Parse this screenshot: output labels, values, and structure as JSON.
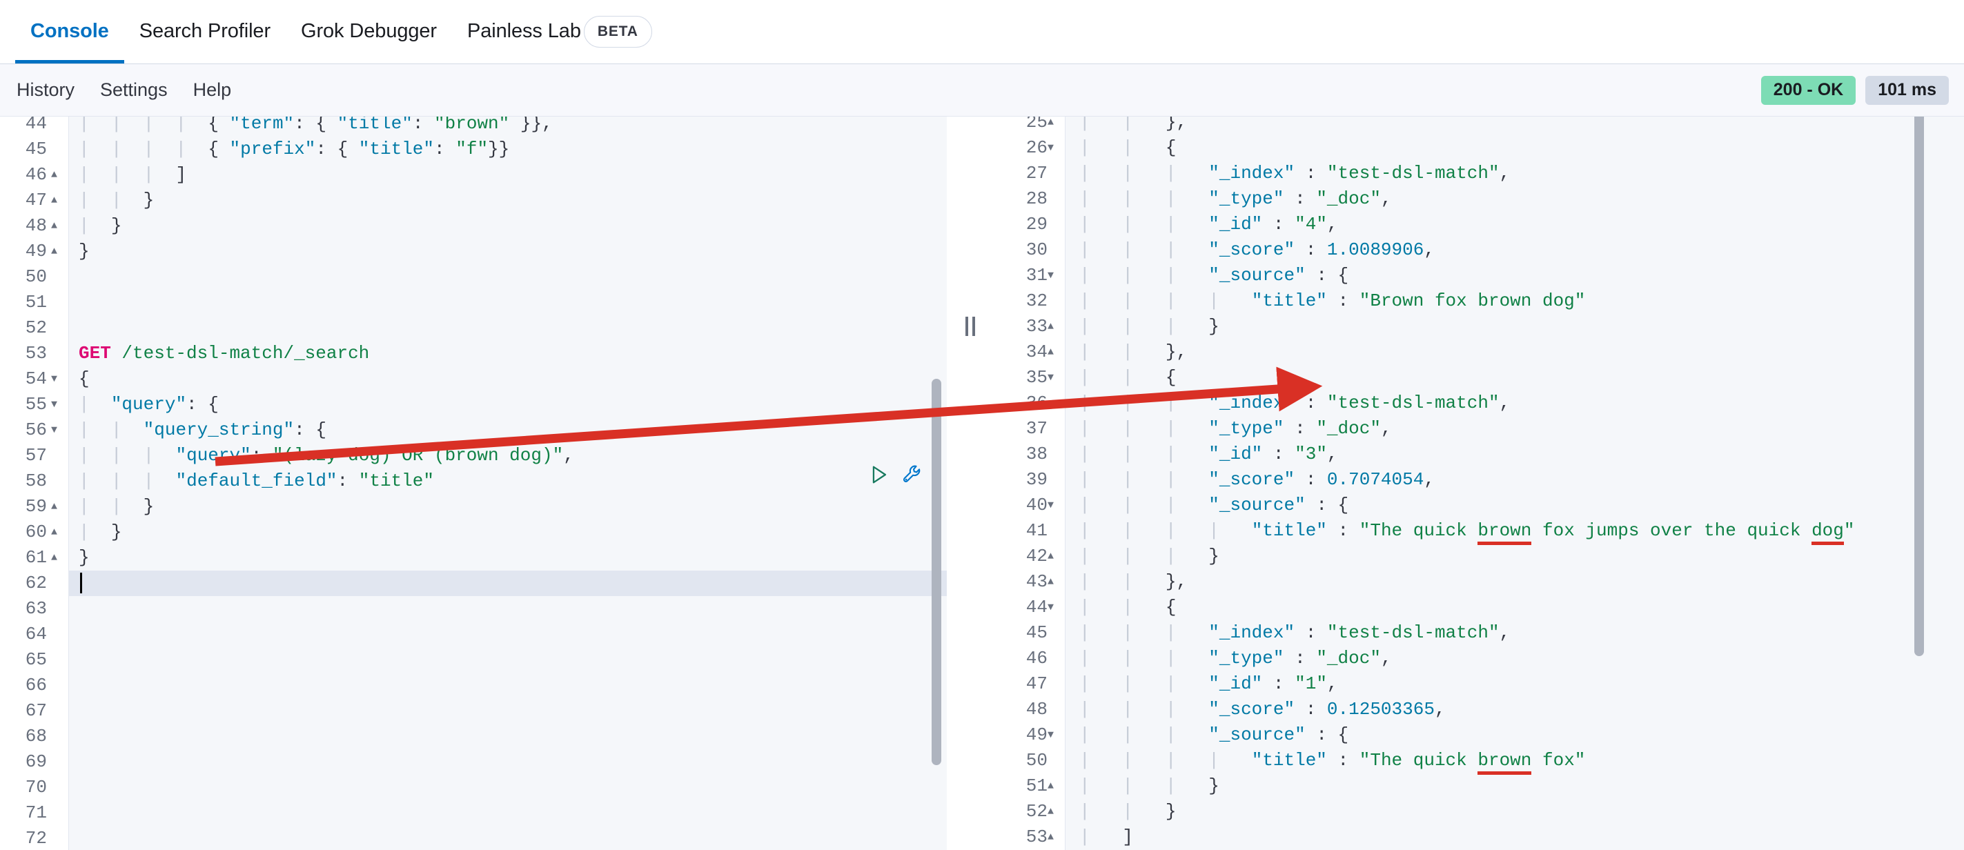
{
  "tabs": [
    {
      "label": "Console",
      "active": true
    },
    {
      "label": "Search Profiler",
      "active": false
    },
    {
      "label": "Grok Debugger",
      "active": false
    },
    {
      "label": "Painless Lab",
      "active": false
    }
  ],
  "beta_badge": "BETA",
  "subbar": {
    "items": [
      "History",
      "Settings",
      "Help"
    ],
    "status_code": "200 - OK",
    "status_time": "101 ms",
    "status_ok_color": "#7DDCB5",
    "status_time_color": "#D3DAE6"
  },
  "editor": {
    "icons": {
      "run": "play-icon",
      "wrench": "wrench-icon"
    },
    "active_line": 62,
    "lines": [
      {
        "n": 44,
        "fold": "",
        "text": "{ \"term\": { \"title\": \"brown\" }},"
      },
      {
        "n": 45,
        "fold": "",
        "text": "{ \"prefix\": { \"title\": \"f\"}}"
      },
      {
        "n": 46,
        "fold": "▲",
        "text": "]"
      },
      {
        "n": 47,
        "fold": "▲",
        "text": "}"
      },
      {
        "n": 48,
        "fold": "▲",
        "text": "}"
      },
      {
        "n": 49,
        "fold": "▲",
        "text": "}"
      },
      {
        "n": 50,
        "fold": "",
        "text": ""
      },
      {
        "n": 51,
        "fold": "",
        "text": ""
      },
      {
        "n": 52,
        "fold": "",
        "text": ""
      },
      {
        "n": 53,
        "fold": "",
        "text": "GET /test-dsl-match/_search"
      },
      {
        "n": 54,
        "fold": "▼",
        "text": "{"
      },
      {
        "n": 55,
        "fold": "▼",
        "text": "\"query\": {"
      },
      {
        "n": 56,
        "fold": "▼",
        "text": "\"query_string\": {"
      },
      {
        "n": 57,
        "fold": "",
        "text": "\"query\": \"(lazy dog) OR (brown dog)\","
      },
      {
        "n": 58,
        "fold": "",
        "text": "\"default_field\": \"title\""
      },
      {
        "n": 59,
        "fold": "▲",
        "text": "}"
      },
      {
        "n": 60,
        "fold": "▲",
        "text": "}"
      },
      {
        "n": 61,
        "fold": "▲",
        "text": "}"
      },
      {
        "n": 62,
        "fold": "",
        "text": ""
      },
      {
        "n": 63,
        "fold": "",
        "text": ""
      },
      {
        "n": 64,
        "fold": "",
        "text": ""
      },
      {
        "n": 65,
        "fold": "",
        "text": ""
      },
      {
        "n": 66,
        "fold": "",
        "text": ""
      },
      {
        "n": 67,
        "fold": "",
        "text": ""
      },
      {
        "n": 68,
        "fold": "",
        "text": ""
      },
      {
        "n": 69,
        "fold": "",
        "text": ""
      },
      {
        "n": 70,
        "fold": "",
        "text": ""
      },
      {
        "n": 71,
        "fold": "",
        "text": ""
      },
      {
        "n": 72,
        "fold": "",
        "text": ""
      }
    ]
  },
  "response": {
    "lines": [
      {
        "n": 25,
        "fold": "▲",
        "text": "},"
      },
      {
        "n": 26,
        "fold": "▼",
        "text": "{"
      },
      {
        "n": 27,
        "fold": "",
        "text": "\"_index\" : \"test-dsl-match\","
      },
      {
        "n": 28,
        "fold": "",
        "text": "\"_type\" : \"_doc\","
      },
      {
        "n": 29,
        "fold": "",
        "text": "\"_id\" : \"4\","
      },
      {
        "n": 30,
        "fold": "",
        "text": "\"_score\" : 1.0089906,"
      },
      {
        "n": 31,
        "fold": "▼",
        "text": "\"_source\" : {"
      },
      {
        "n": 32,
        "fold": "",
        "text": "\"title\" : \"Brown fox brown dog\""
      },
      {
        "n": 33,
        "fold": "▲",
        "text": "}"
      },
      {
        "n": 34,
        "fold": "▲",
        "text": "},"
      },
      {
        "n": 35,
        "fold": "▼",
        "text": "{"
      },
      {
        "n": 36,
        "fold": "",
        "text": "\"_index\" : \"test-dsl-match\","
      },
      {
        "n": 37,
        "fold": "",
        "text": "\"_type\" : \"_doc\","
      },
      {
        "n": 38,
        "fold": "",
        "text": "\"_id\" : \"3\","
      },
      {
        "n": 39,
        "fold": "",
        "text": "\"_score\" : 0.7074054,"
      },
      {
        "n": 40,
        "fold": "▼",
        "text": "\"_source\" : {"
      },
      {
        "n": 41,
        "fold": "",
        "text": "\"title\" : \"The quick brown fox jumps over the quick dog\""
      },
      {
        "n": 42,
        "fold": "▲",
        "text": "}"
      },
      {
        "n": 43,
        "fold": "▲",
        "text": "},"
      },
      {
        "n": 44,
        "fold": "▼",
        "text": "{"
      },
      {
        "n": 45,
        "fold": "",
        "text": "\"_index\" : \"test-dsl-match\","
      },
      {
        "n": 46,
        "fold": "",
        "text": "\"_type\" : \"_doc\","
      },
      {
        "n": 47,
        "fold": "",
        "text": "\"_id\" : \"1\","
      },
      {
        "n": 48,
        "fold": "",
        "text": "\"_score\" : 0.12503365,"
      },
      {
        "n": 49,
        "fold": "▼",
        "text": "\"_source\" : {"
      },
      {
        "n": 50,
        "fold": "",
        "text": "\"title\" : \"The quick brown fox\""
      },
      {
        "n": 51,
        "fold": "▲",
        "text": "}"
      },
      {
        "n": 52,
        "fold": "▲",
        "text": "}"
      },
      {
        "n": 53,
        "fold": "▲",
        "text": "]"
      }
    ],
    "hits": [
      {
        "_index": "test-dsl-match",
        "_type": "_doc",
        "_id": "4",
        "_score": "1.0089906",
        "title": "Brown fox brown dog"
      },
      {
        "_index": "test-dsl-match",
        "_type": "_doc",
        "_id": "3",
        "_score": "0.7074054",
        "title": "The quick brown fox jumps over the quick dog"
      },
      {
        "_index": "test-dsl-match",
        "_type": "_doc",
        "_id": "1",
        "_score": "0.12503365",
        "title": "The quick brown fox"
      }
    ]
  },
  "annotations": {
    "arrow_color": "#D93025",
    "underline_color": "#D93025",
    "underlined_terms": [
      "brown",
      "dog",
      "brown"
    ]
  }
}
